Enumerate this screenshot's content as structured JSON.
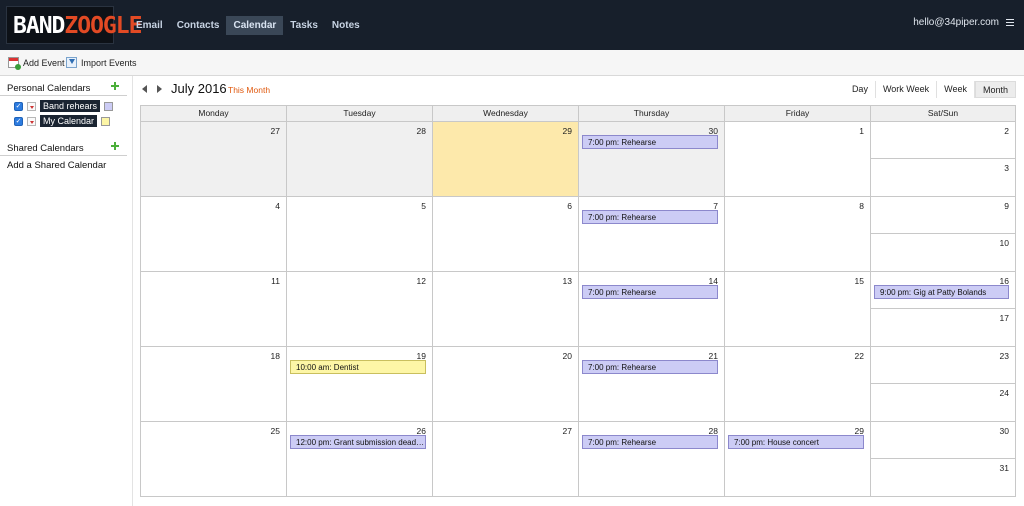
{
  "logo": {
    "part1": "BAND",
    "part2": "ZOOGLE"
  },
  "nav": [
    {
      "label": "Email",
      "active": false
    },
    {
      "label": "Contacts",
      "active": false
    },
    {
      "label": "Calendar",
      "active": true
    },
    {
      "label": "Tasks",
      "active": false
    },
    {
      "label": "Notes",
      "active": false
    }
  ],
  "user": {
    "email": "hello@34piper.com"
  },
  "toolbar": {
    "add_event": "Add Event",
    "import_events": "Import Events"
  },
  "sidebar": {
    "personal_title": "Personal Calendars",
    "calendars": [
      {
        "name": "Band rehears",
        "color": "#ccccf5",
        "checked": true
      },
      {
        "name": "My Calendar",
        "color": "#fdf6a6",
        "checked": true
      }
    ],
    "shared_title": "Shared Calendars",
    "add_shared": "Add a Shared Calendar"
  },
  "header": {
    "month": "July 2016",
    "this_month": "This Month",
    "views": [
      "Day",
      "Work Week",
      "Week",
      "Month"
    ],
    "active_view": "Month"
  },
  "colors": {
    "accent": "#e05a10",
    "nav_bg": "#171f2b",
    "today": "#fde9ab",
    "band": "#ccccf5",
    "mine": "#fdf6a6"
  },
  "days_of_week": [
    "Monday",
    "Tuesday",
    "Wednesday",
    "Thursday",
    "Friday",
    "Sat/Sun"
  ],
  "weeks": [
    {
      "days": [
        {
          "num": "27",
          "muted": true
        },
        {
          "num": "28",
          "muted": true
        },
        {
          "num": "29",
          "today": true
        },
        {
          "num": "30",
          "muted": true,
          "event": {
            "text": "7:00 pm: Rehearse",
            "cal": "band"
          }
        },
        {
          "num": "1"
        }
      ],
      "sat": {
        "num": "2"
      },
      "sun": {
        "num": "3"
      }
    },
    {
      "days": [
        {
          "num": "4"
        },
        {
          "num": "5"
        },
        {
          "num": "6"
        },
        {
          "num": "7",
          "event": {
            "text": "7:00 pm: Rehearse",
            "cal": "band"
          }
        },
        {
          "num": "8"
        }
      ],
      "sat": {
        "num": "9"
      },
      "sun": {
        "num": "10"
      }
    },
    {
      "days": [
        {
          "num": "11"
        },
        {
          "num": "12"
        },
        {
          "num": "13"
        },
        {
          "num": "14",
          "event": {
            "text": "7:00 pm: Rehearse",
            "cal": "band"
          }
        },
        {
          "num": "15"
        }
      ],
      "sat": {
        "num": "16",
        "event": {
          "text": "9:00 pm: Gig at Patty Bolands",
          "cal": "band"
        }
      },
      "sun": {
        "num": "17"
      }
    },
    {
      "days": [
        {
          "num": "18"
        },
        {
          "num": "19",
          "event": {
            "text": "10:00 am: Dentist",
            "cal": "mine"
          }
        },
        {
          "num": "20"
        },
        {
          "num": "21",
          "event": {
            "text": "7:00 pm: Rehearse",
            "cal": "band"
          }
        },
        {
          "num": "22"
        }
      ],
      "sat": {
        "num": "23"
      },
      "sun": {
        "num": "24"
      }
    },
    {
      "days": [
        {
          "num": "25"
        },
        {
          "num": "26",
          "event": {
            "text": "12:00 pm: Grant submission deadli...",
            "cal": "band"
          }
        },
        {
          "num": "27"
        },
        {
          "num": "28",
          "event": {
            "text": "7:00 pm: Rehearse",
            "cal": "band"
          }
        },
        {
          "num": "29",
          "event": {
            "text": "7:00 pm: House concert",
            "cal": "band"
          }
        }
      ],
      "sat": {
        "num": "30"
      },
      "sun": {
        "num": "31"
      }
    }
  ]
}
